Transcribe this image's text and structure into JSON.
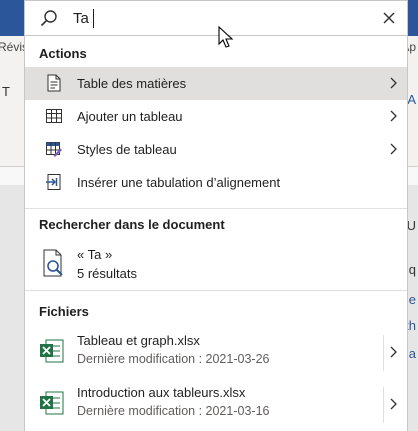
{
  "search": {
    "value": "Ta"
  },
  "background": {
    "ribbon_tab_left": "Révis",
    "ribbon_tab_right": "Ap"
  },
  "sections": {
    "actions_title": "Actions",
    "document_title": "Rechercher dans le document",
    "files_title": "Fichiers"
  },
  "actions": [
    {
      "label": "Table des matières",
      "icon": "table-of-contents-icon",
      "has_submenu": true,
      "selected": true
    },
    {
      "label": "Ajouter un tableau",
      "icon": "table-grid-icon",
      "has_submenu": true
    },
    {
      "label": "Styles de tableau",
      "icon": "table-styles-icon",
      "has_submenu": true
    },
    {
      "label": "Insérer une tabulation d’alignement",
      "icon": "alignment-tab-icon",
      "has_submenu": false
    }
  ],
  "document_result": {
    "query": "« Ta »",
    "count": "5 résultats",
    "icon": "document-search-icon"
  },
  "files": [
    {
      "name": "Tableau et graph.xlsx",
      "modified": "Dernière modification : 2021-03-26",
      "icon": "excel-file-icon"
    },
    {
      "name": "Introduction aux tableurs.xlsx",
      "modified": "Dernière modification : 2021-03-16",
      "icon": "excel-file-icon"
    }
  ],
  "colors": {
    "word_blue": "#2b579a",
    "selected_row": "#e1dfdd",
    "excel_green": "#217346"
  }
}
